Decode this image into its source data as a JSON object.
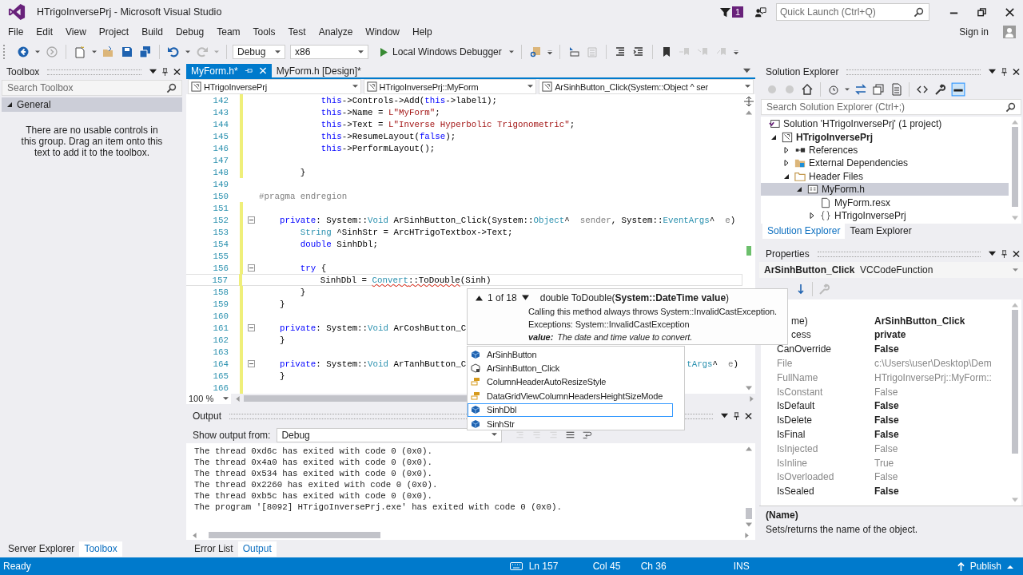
{
  "window": {
    "title": "HTrigoInversePrj - Microsoft Visual Studio",
    "notification_count": "1",
    "quick_launch": {
      "placeholder": "Quick Launch (Ctrl+Q)"
    }
  },
  "menu": [
    "File",
    "Edit",
    "View",
    "Project",
    "Build",
    "Debug",
    "Team",
    "Tools",
    "Test",
    "Analyze",
    "Window",
    "Help"
  ],
  "sign_in": "Sign in",
  "toolbar": {
    "configuration": "Debug",
    "platform": "x86",
    "debugger": "Local Windows Debugger"
  },
  "toolbox": {
    "title": "Toolbox",
    "search": {
      "placeholder": "Search Toolbox"
    },
    "group": {
      "label": "General",
      "expanded": true
    },
    "message": "There are no usable controls in this group. Drag an item onto this text to add it to the toolbox.",
    "tabs": [
      {
        "label": "Server Explorer",
        "selected": false
      },
      {
        "label": "Toolbox",
        "selected": true
      }
    ]
  },
  "editor": {
    "tabs": [
      {
        "label": "MyForm.h*",
        "selected": true
      },
      {
        "label": "MyForm.h [Design]*",
        "selected": false
      }
    ],
    "nav": [
      "HTrigoInversePrj",
      "HTrigoInversePrj::MyForm",
      "ArSinhButton_Click(System::Object ^ ser"
    ],
    "lines": [
      {
        "number": "142",
        "modified": true,
        "fold": false,
        "current": false,
        "segs": [
          {
            "kind": "k",
            "text": "            this"
          },
          {
            "kind": "p",
            "text": "->Controls->Add("
          },
          {
            "kind": "k",
            "text": "this"
          },
          {
            "kind": "p",
            "text": "->label1);"
          }
        ]
      },
      {
        "number": "143",
        "modified": true,
        "fold": false,
        "current": false,
        "segs": [
          {
            "kind": "k",
            "text": "            this"
          },
          {
            "kind": "p",
            "text": "->Name = "
          },
          {
            "kind": "s",
            "text": "L\"MyForm\""
          },
          {
            "kind": "p",
            "text": ";"
          }
        ]
      },
      {
        "number": "144",
        "modified": true,
        "fold": false,
        "current": false,
        "segs": [
          {
            "kind": "k",
            "text": "            this"
          },
          {
            "kind": "p",
            "text": "->Text = "
          },
          {
            "kind": "s",
            "text": "L\"Inverse Hyperbolic Trigonometric\""
          },
          {
            "kind": "p",
            "text": ";"
          }
        ]
      },
      {
        "number": "145",
        "modified": true,
        "fold": false,
        "current": false,
        "segs": [
          {
            "kind": "k",
            "text": "            this"
          },
          {
            "kind": "p",
            "text": "->ResumeLayout("
          },
          {
            "kind": "k",
            "text": "false"
          },
          {
            "kind": "p",
            "text": ");"
          }
        ]
      },
      {
        "number": "146",
        "modified": true,
        "fold": false,
        "current": false,
        "segs": [
          {
            "kind": "k",
            "text": "            this"
          },
          {
            "kind": "p",
            "text": "->PerformLayout();"
          }
        ]
      },
      {
        "number": "147",
        "modified": true,
        "fold": false,
        "current": false
      },
      {
        "number": "148",
        "modified": true,
        "fold": false,
        "current": false,
        "segs": [
          {
            "kind": "p",
            "text": "        }"
          }
        ]
      },
      {
        "number": "149",
        "modified": false,
        "fold": false,
        "current": false
      },
      {
        "number": "150",
        "modified": false,
        "fold": false,
        "current": false,
        "segs": [
          {
            "kind": "m",
            "text": "#pragma endregion"
          }
        ]
      },
      {
        "number": "151",
        "modified": true,
        "fold": false,
        "current": false
      },
      {
        "number": "152",
        "modified": true,
        "fold": true,
        "current": false,
        "segs": [
          {
            "kind": "k",
            "text": "    private"
          },
          {
            "kind": "p",
            "text": ": System::"
          },
          {
            "kind": "t",
            "text": "Void"
          },
          {
            "kind": "p",
            "text": " ArSinhButton_Click(System::"
          },
          {
            "kind": "t",
            "text": "Object"
          },
          {
            "kind": "p",
            "text": "^  "
          },
          {
            "kind": "g",
            "text": "sender"
          },
          {
            "kind": "p",
            "text": ", System::"
          },
          {
            "kind": "t",
            "text": "EventArgs"
          },
          {
            "kind": "p",
            "text": "^  "
          },
          {
            "kind": "g",
            "text": "e"
          },
          {
            "kind": "p",
            "text": ")"
          }
        ]
      },
      {
        "number": "153",
        "modified": true,
        "fold": false,
        "current": false,
        "segs": [
          {
            "kind": "t",
            "text": "        String"
          },
          {
            "kind": "p",
            "text": " ^SinhStr = ArcHTrigoTextbox->Text;"
          }
        ]
      },
      {
        "number": "154",
        "modified": true,
        "fold": false,
        "current": false,
        "segs": [
          {
            "kind": "k",
            "text": "        double"
          },
          {
            "kind": "p",
            "text": " SinhDbl;"
          }
        ]
      },
      {
        "number": "155",
        "modified": true,
        "fold": false,
        "current": false
      },
      {
        "number": "156",
        "modified": true,
        "fold": true,
        "current": false,
        "segs": [
          {
            "kind": "k",
            "text": "        try"
          },
          {
            "kind": "p",
            "text": " {"
          }
        ]
      },
      {
        "number": "157",
        "modified": true,
        "fold": false,
        "current": true,
        "segs": [
          {
            "kind": "p",
            "text": "            SinhDbl = "
          },
          {
            "kind": "te",
            "text": "Convert"
          },
          {
            "kind": "pe",
            "text": "::ToDouble"
          },
          {
            "kind": "p",
            "text": "(Sinh)"
          }
        ]
      },
      {
        "number": "158",
        "modified": true,
        "fold": false,
        "current": false,
        "segs": [
          {
            "kind": "p",
            "text": "        }"
          }
        ]
      },
      {
        "number": "159",
        "modified": true,
        "fold": false,
        "current": false,
        "segs": [
          {
            "kind": "p",
            "text": "    }"
          }
        ]
      },
      {
        "number": "160",
        "modified": true,
        "fold": false,
        "current": false
      },
      {
        "number": "161",
        "modified": true,
        "fold": true,
        "current": false,
        "segs": [
          {
            "kind": "k",
            "text": "    private"
          },
          {
            "kind": "p",
            "text": ": System::"
          },
          {
            "kind": "t",
            "text": "Void"
          },
          {
            "kind": "p",
            "text": " ArCoshButton_C"
          }
        ]
      },
      {
        "number": "162",
        "modified": true,
        "fold": false,
        "current": false,
        "segs": [
          {
            "kind": "p",
            "text": "    }"
          }
        ]
      },
      {
        "number": "163",
        "modified": true,
        "fold": false,
        "current": false
      },
      {
        "number": "164",
        "modified": true,
        "fold": true,
        "current": false,
        "segs": [
          {
            "kind": "k",
            "text": "    private"
          },
          {
            "kind": "p",
            "text": ": System::"
          },
          {
            "kind": "t",
            "text": "Void"
          },
          {
            "kind": "p",
            "text": " ArTanhButton_C"
          }
        ],
        "tail": [
          {
            "kind": "t",
            "text": "tArgs"
          },
          {
            "kind": "p",
            "text": "^  "
          },
          {
            "kind": "g",
            "text": "e"
          },
          {
            "kind": "p",
            "text": ")"
          }
        ]
      },
      {
        "number": "165",
        "modified": true,
        "fold": false,
        "current": false,
        "segs": [
          {
            "kind": "p",
            "text": "    }"
          }
        ]
      },
      {
        "number": "166",
        "modified": true,
        "fold": false,
        "current": false
      }
    ],
    "zoom": "100 %"
  },
  "signature_help": {
    "counter": "1 of 18",
    "signature": "double ToDouble(**System::DateTime value**)",
    "description": "Calling this method always throws System::InvalidCastException.",
    "exceptions": "Exceptions: System::InvalidCastException",
    "param_name": "value:",
    "param_description": "The date and time value to convert."
  },
  "completion": [
    {
      "label": "ArSinhButton",
      "kind": "field",
      "selected": false
    },
    {
      "label": "ArSinhButton_Click",
      "kind": "method",
      "selected": false
    },
    {
      "label": "ColumnHeaderAutoResizeStyle",
      "kind": "enum",
      "selected": false
    },
    {
      "label": "DataGridViewColumnHeadersHeightSizeMode",
      "kind": "enum",
      "selected": false
    },
    {
      "label": "SinhDbl",
      "kind": "field",
      "selected": true
    },
    {
      "label": "SinhStr",
      "kind": "field",
      "selected": false
    }
  ],
  "output": {
    "title": "Output",
    "source_label": "Show output from:",
    "source": "Debug",
    "lines": [
      "The thread 0xd6c has exited with code 0 (0x0).",
      "The thread 0x4a0 has exited with code 0 (0x0).",
      "The thread 0x534 has exited with code 0 (0x0).",
      "The thread 0x2260 has exited with code 0 (0x0).",
      "The thread 0xb5c has exited with code 0 (0x0).",
      "The program '[8092] HTrigoInversePrj.exe' has exited with code 0 (0x0)."
    ],
    "tabs": [
      {
        "label": "Error List",
        "selected": false
      },
      {
        "label": "Output",
        "selected": true
      }
    ]
  },
  "solution_explorer": {
    "title": "Solution Explorer",
    "search": {
      "placeholder": "Search Solution Explorer (Ctrl+;)"
    },
    "tree": [
      {
        "label": "Solution 'HTrigoInversePrj' (1 project)",
        "kind": "solution",
        "selected": false,
        "children": [
          {
            "label": "HTrigoInversePrj",
            "kind": "project",
            "expanded": true,
            "selected": false,
            "children": [
              {
                "label": "References",
                "kind": "references",
                "expanded": false,
                "selected": false
              },
              {
                "label": "External Dependencies",
                "kind": "external",
                "expanded": false,
                "selected": false
              },
              {
                "label": "Header Files",
                "kind": "folder",
                "expanded": true,
                "selected": false,
                "children": [
                  {
                    "label": "MyForm.h",
                    "kind": "header",
                    "expanded": true,
                    "selected": true,
                    "children": [
                      {
                        "label": "MyForm.resx",
                        "kind": "resource",
                        "selected": false
                      },
                      {
                        "label": "HTrigoInversePrj",
                        "kind": "namespace",
                        "expanded": false,
                        "selected": false
                      }
                    ]
                  }
                ]
              }
            ]
          }
        ]
      }
    ],
    "tabs": [
      {
        "label": "Solution Explorer",
        "selected": true
      },
      {
        "label": "Team Explorer",
        "selected": false
      }
    ]
  },
  "properties": {
    "title": "Properties",
    "object_name": "ArSinhButton_Click",
    "object_type": "VCCodeFunction",
    "rows": [
      {
        "name": "me)",
        "value": "ArSinhButton_Click",
        "readonly": false,
        "covered": true
      },
      {
        "name": "cess",
        "value": "private",
        "readonly": false,
        "covered": true
      },
      {
        "name": "CanOverride",
        "value": "False",
        "readonly": false,
        "covered": false
      },
      {
        "name": "File",
        "value": "c:\\Users\\user\\Desktop\\Dem",
        "readonly": true,
        "covered": false
      },
      {
        "name": "FullName",
        "value": "HTrigoInversePrj::MyForm::",
        "readonly": true,
        "covered": false
      },
      {
        "name": "IsConstant",
        "value": "False",
        "readonly": true,
        "covered": false
      },
      {
        "name": "IsDefault",
        "value": "False",
        "readonly": false,
        "covered": false
      },
      {
        "name": "IsDelete",
        "value": "False",
        "readonly": false,
        "covered": false
      },
      {
        "name": "IsFinal",
        "value": "False",
        "readonly": false,
        "covered": false
      },
      {
        "name": "IsInjected",
        "value": "False",
        "readonly": true,
        "covered": false
      },
      {
        "name": "IsInline",
        "value": "True",
        "readonly": true,
        "covered": false
      },
      {
        "name": "IsOverloaded",
        "value": "False",
        "readonly": true,
        "covered": false
      },
      {
        "name": "IsSealed",
        "value": "False",
        "readonly": false,
        "covered": false
      }
    ],
    "description_title": "(Name)",
    "description": "Sets/returns the name of the object."
  },
  "status_bar": {
    "text": "Ready",
    "line": "Ln 157",
    "col": "Col 45",
    "ch": "Ch 36",
    "mode": "INS",
    "publish": "Publish"
  }
}
